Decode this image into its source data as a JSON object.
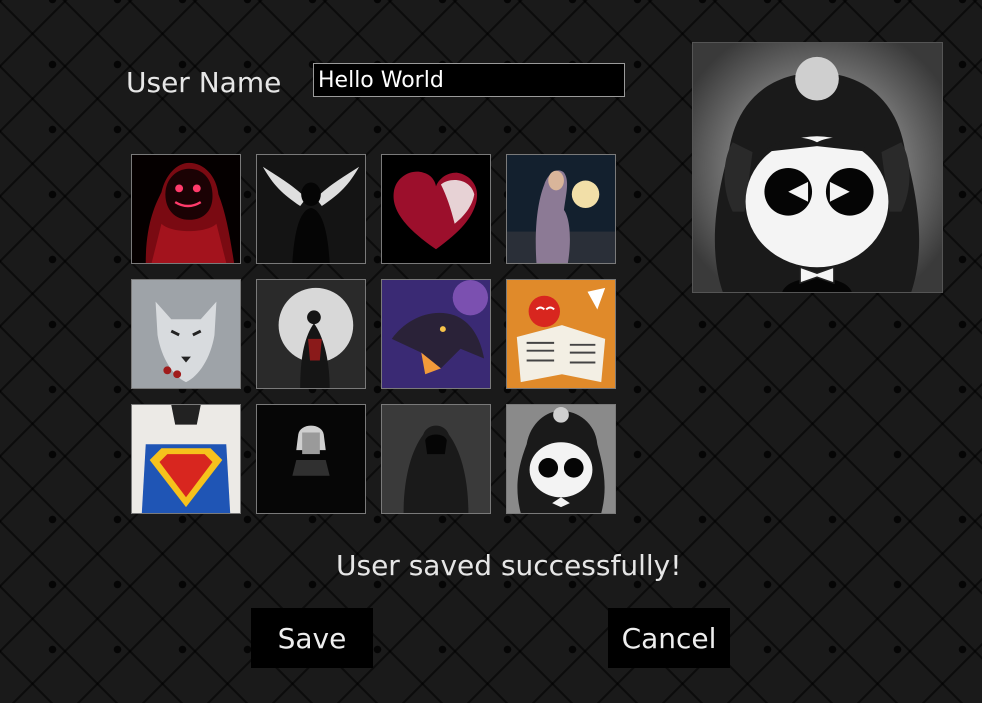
{
  "form": {
    "user_name_label": "User Name",
    "user_name_value": "Hello World"
  },
  "avatars": [
    {
      "icon": "red-hooded-neon-mask-avatar"
    },
    {
      "icon": "angel-wings-silhouette-avatar"
    },
    {
      "icon": "crimson-heart-avatar"
    },
    {
      "icon": "woman-holding-glowing-moon-avatar"
    },
    {
      "icon": "snow-wolf-avatar"
    },
    {
      "icon": "samurai-under-moon-avatar"
    },
    {
      "icon": "purple-dragon-avatar"
    },
    {
      "icon": "spider-man-reading-newspaper-avatar"
    },
    {
      "icon": "superman-shirt-rip-avatar"
    },
    {
      "icon": "joker-dark-avatar"
    },
    {
      "icon": "hooded-figure-dark-avatar"
    },
    {
      "icon": "cartoon-girl-bw-avatar"
    }
  ],
  "selected_avatar_index": 11,
  "status_message": "User saved successfully!",
  "buttons": {
    "save_label": "Save",
    "cancel_label": "Cancel"
  },
  "colors": {
    "background": "#1a1a1a",
    "input_background": "#000000",
    "button_background": "#000000",
    "text": "#e6e6e6"
  }
}
